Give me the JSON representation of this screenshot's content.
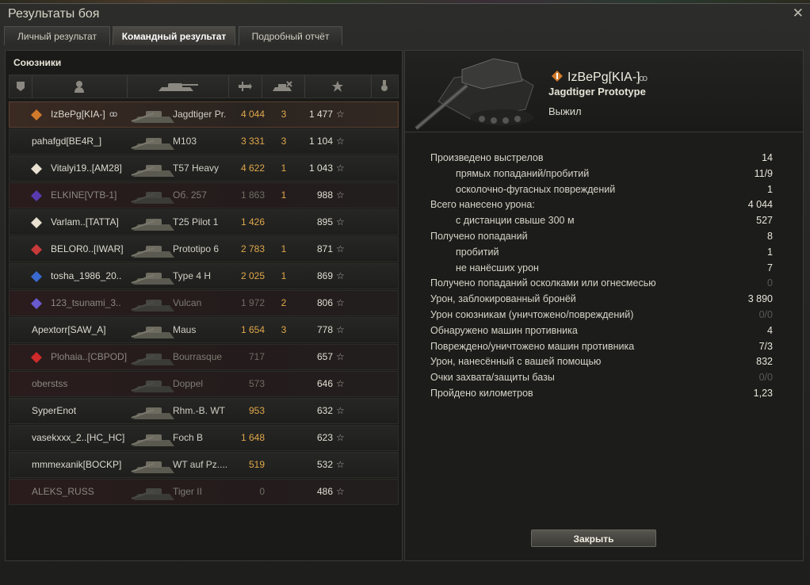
{
  "window": {
    "title": "Результаты боя",
    "close_glyph": "✕"
  },
  "tabs": [
    {
      "label": "Личный результат",
      "active": false
    },
    {
      "label": "Командный результат",
      "active": true
    },
    {
      "label": "Подробный отчёт",
      "active": false
    }
  ],
  "team": {
    "title": "Союзники",
    "columns": [
      "squad-icon",
      "player-icon",
      "tank-icon",
      "damage-icon",
      "kills-icon",
      "xp-star-icon",
      "medal-icon"
    ],
    "rows": [
      {
        "player": "IzBePg[KIA-]",
        "tank": "Jagdtiger Pr.",
        "damage": "4 044",
        "kills": "3",
        "xp": "1 477",
        "alive": true,
        "self": true,
        "clan_color": "#d07a2a",
        "hidden_icon": "ꝏ"
      },
      {
        "player": "pahafgd[BE4R_]",
        "tank": "M103",
        "damage": "3 331",
        "kills": "3",
        "xp": "1 104",
        "alive": true
      },
      {
        "player": "Vitalyi19..[AM28]",
        "tank": "T57 Heavy",
        "damage": "4 622",
        "kills": "1",
        "xp": "1 043",
        "alive": true,
        "clan_color": "#e8e0d0"
      },
      {
        "player": "ELKINE[VTB-1]",
        "tank": "Об. 257",
        "damage": "1 863",
        "kills": "1",
        "xp": "988",
        "alive": false,
        "clan_color": "#5a3ab0"
      },
      {
        "player": "Varlam..[TATTA]",
        "tank": "T25 Pilot 1",
        "damage": "1 426",
        "kills": "",
        "xp": "895",
        "alive": true,
        "clan_color": "#e8e0d0"
      },
      {
        "player": "BELOR0..[IWAR]",
        "tank": "Prototipo 6",
        "damage": "2 783",
        "kills": "1",
        "xp": "871",
        "alive": true,
        "clan_color": "#c83a3a"
      },
      {
        "player": "tosha_1986_20..",
        "tank": "Type 4 H",
        "damage": "2 025",
        "kills": "1",
        "xp": "869",
        "alive": true,
        "clan_color": "#3a6ad0"
      },
      {
        "player": "123_tsunami_3..",
        "tank": "Vulcan",
        "damage": "1 972",
        "kills": "2",
        "xp": "806",
        "alive": false,
        "clan_color": "#6a5ad0"
      },
      {
        "player": "Apextorr[SAW_A]",
        "tank": "Maus",
        "damage": "1 654",
        "kills": "3",
        "xp": "778",
        "alive": true
      },
      {
        "player": "Plohaia..[CBPOD]",
        "tank": "Bourrasque",
        "damage": "717",
        "kills": "",
        "xp": "657",
        "alive": false,
        "clan_color": "#d02a2a"
      },
      {
        "player": "oberstss",
        "tank": "Doppel",
        "damage": "573",
        "kills": "",
        "xp": "646",
        "alive": false
      },
      {
        "player": "SyperEnot",
        "tank": "Rhm.-B. WT",
        "damage": "953",
        "kills": "",
        "xp": "632",
        "alive": true
      },
      {
        "player": "vasekxxx_2..[HC_HC]",
        "tank": "Foch B",
        "damage": "1 648",
        "kills": "",
        "xp": "623",
        "alive": true
      },
      {
        "player": "mmmexanik[BOCKP]",
        "tank": "WT auf Pz....",
        "damage": "519",
        "kills": "",
        "xp": "532",
        "alive": true
      },
      {
        "player": "ALEKS_RUSS",
        "tank": "Tiger II",
        "damage": "0",
        "kills": "",
        "xp": "486",
        "alive": false
      }
    ]
  },
  "detail": {
    "player": "IzBePg[KIA-]",
    "hidden_icon": "ꝏ",
    "tank": "Jagdtiger Prototype",
    "status": "Выжил",
    "stats": [
      {
        "label": "Произведено выстрелов",
        "value": "14",
        "indent": false
      },
      {
        "label": "прямых попаданий/пробитий",
        "value": "11/9",
        "indent": true
      },
      {
        "label": "осколочно-фугасных повреждений",
        "value": "1",
        "indent": true
      },
      {
        "label": "Всего нанесено урона:",
        "value": "4 044",
        "indent": false
      },
      {
        "label": "с дистанции свыше 300 м",
        "value": "527",
        "indent": true
      },
      {
        "label": "Получено попаданий",
        "value": "8",
        "indent": false
      },
      {
        "label": "пробитий",
        "value": "1",
        "indent": true
      },
      {
        "label": "не нанёсших урон",
        "value": "7",
        "indent": true
      },
      {
        "label": "Получено попаданий осколками или огнесмесью",
        "value": "0",
        "indent": false,
        "zero": true
      },
      {
        "label": "Урон, заблокированный бронёй",
        "value": "3 890",
        "indent": false
      },
      {
        "label": "Урон союзникам (уничтожено/повреждений)",
        "value": "0/0",
        "indent": false,
        "zero": true
      },
      {
        "label": "Обнаружено машин противника",
        "value": "4",
        "indent": false
      },
      {
        "label": "Повреждено/уничтожено машин противника",
        "value": "7/3",
        "indent": false
      },
      {
        "label": "Урон, нанесённый с вашей помощью",
        "value": "832",
        "indent": false
      },
      {
        "label": "Очки захвата/защиты базы",
        "value": "0/0",
        "indent": false,
        "zero": true
      },
      {
        "label": "Пройдено километров",
        "value": "1,23",
        "indent": false
      }
    ],
    "close_label": "Закрыть"
  },
  "colors": {
    "accent": "#e0a84a",
    "dead_text": "#8a8880",
    "self_row": "#3a2a22"
  },
  "star_glyph": "☆"
}
